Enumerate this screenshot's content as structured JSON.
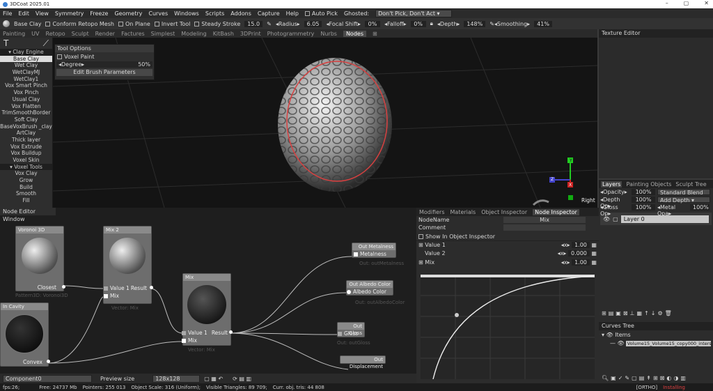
{
  "window": {
    "title": "3DCoat 2025.01"
  },
  "menu": [
    "File",
    "Edit",
    "View",
    "Symmetry",
    "Freeze",
    "Geometry",
    "Curves",
    "Windows",
    "Scripts",
    "Addons",
    "Capture",
    "Help"
  ],
  "menu_extra": {
    "auto_pick": "Auto Pick",
    "ghosted_label": "Ghosted:",
    "ghosted_value": "Don't Pick, Don't Act"
  },
  "toolbar": {
    "brush": "Base Clay",
    "conform": "Conform Retopo Mesh",
    "on_plane": "On Plane",
    "invert": "Invert Tool",
    "steady": "Steady Stroke",
    "steady_val": "15.0",
    "radius": "Radius",
    "radius_val": "6.05",
    "focal": "Focal Shift",
    "focal_val": "0%",
    "falloff": "Falloff",
    "falloff_val": "0%",
    "depth": "Depth",
    "depth_val": "148%",
    "smoothing": "Smoothing",
    "smoothing_val": "41%"
  },
  "tabs": [
    "Painting",
    "UV",
    "Retopo",
    "Sculpt",
    "Render",
    "Factures",
    "Simplest",
    "Modeling",
    "KitBash",
    "3DPrint",
    "Photogrammetry",
    "Nurbs",
    "Nodes"
  ],
  "active_tab": "Nodes",
  "brushes": {
    "header1": "Clay Engine",
    "items1": [
      "Base Clay",
      "Wet Clay",
      "WetClayMJ",
      "WetClay1",
      "Vox Smart Pinch",
      "Vox Pinch",
      "Usual Clay",
      "Vox Flatten",
      "TrimSmoothBorder",
      "Soft Clay",
      "BaseVoxBrush _clay",
      "ArtClay",
      "Thick layer",
      "Vox Extrude",
      "Vox Buildup",
      "Voxel Skin"
    ],
    "header2": "Voxel Tools",
    "items2": [
      "Vox Clay",
      "Grow",
      "Build",
      "Smooth",
      "Fill"
    ]
  },
  "tool_options": {
    "title": "Tool Options",
    "voxel_paint": "Voxel Paint",
    "degree": "Degree",
    "degree_val": "50%",
    "edit_btn": "Edit Brush Parameters"
  },
  "viewport": {
    "axis_y": "Y",
    "axis_z": "Z",
    "axis_x": "X",
    "view_label": "Right"
  },
  "texture_editor": {
    "title": "Texture Editor"
  },
  "node_editor": {
    "title": "Node Editor Window",
    "voronoi": {
      "title": "Voronoi 3D",
      "out": "Closest",
      "caption": "Pattern3D: Voronoi3D"
    },
    "mix2": {
      "title": "Mix 2",
      "in1": "Value 1",
      "in2": "Mix",
      "out": "Result",
      "caption": "Vector: Mix"
    },
    "mix": {
      "title": "Mix",
      "in1": "Value 1",
      "in2": "Mix",
      "out": "Result",
      "caption": "Vector: Mix"
    },
    "cavity": {
      "title": "In Cavity",
      "out": "Convex"
    },
    "out_metal": {
      "title": "Out Metalness",
      "in": "Metalness",
      "caption": "Out: outMetalness"
    },
    "out_albedo": {
      "title": "Out Albedo Color",
      "in": "Albedo Color",
      "caption": "Out: outAlbedoColor"
    },
    "out_gloss": {
      "title": "Out Gloss",
      "in": "Gloss",
      "caption": "Out: outGloss"
    },
    "out_disp": {
      "title": "Out Displacement"
    },
    "component": "Component0",
    "preview_label": "Preview size",
    "preview_val": "128x128"
  },
  "inspector": {
    "tabs": [
      "Modifiers",
      "Materials",
      "Object Inspector",
      "Node Inspector"
    ],
    "node_name_lbl": "NodeName",
    "node_name_val": "Mix",
    "comment_lbl": "Comment",
    "show_lbl": "Show In Object Inspector",
    "v1": "Value 1",
    "v1_val": "1.00",
    "v2": "Value 2",
    "v2_val": "0.000",
    "mix": "Mix",
    "mix_val": "1.00"
  },
  "layers": {
    "tabs": [
      "Layers",
      "Painting Objects",
      "Sculpt Tree"
    ],
    "opacity": "Opacity",
    "opacity_val": "100%",
    "blend": "Standard Blend",
    "depth": "Depth Op",
    "depth_val": "100%",
    "add_depth": "Add Depth",
    "gloss": "Gloss Op",
    "gloss_val": "100%",
    "metal": "Metal Opa",
    "metal_val": "100%",
    "layer0": "Layer 0"
  },
  "curves_tree": {
    "title": "Curves Tree",
    "items": "Items",
    "item1": "Volume15_Volume15_copy000_intersect"
  },
  "status": {
    "fps": "fps:26;",
    "free": "Free: 24737 Mb",
    "pointers": "Pointers: 255 013",
    "scale": "Object Scale: 316 (Uniform);",
    "tris": "Visible Triangles: 89 709;",
    "curr": "Curr. obj. tris: 44 808",
    "ortho": "[ORTHO]",
    "installing": "Installing"
  }
}
